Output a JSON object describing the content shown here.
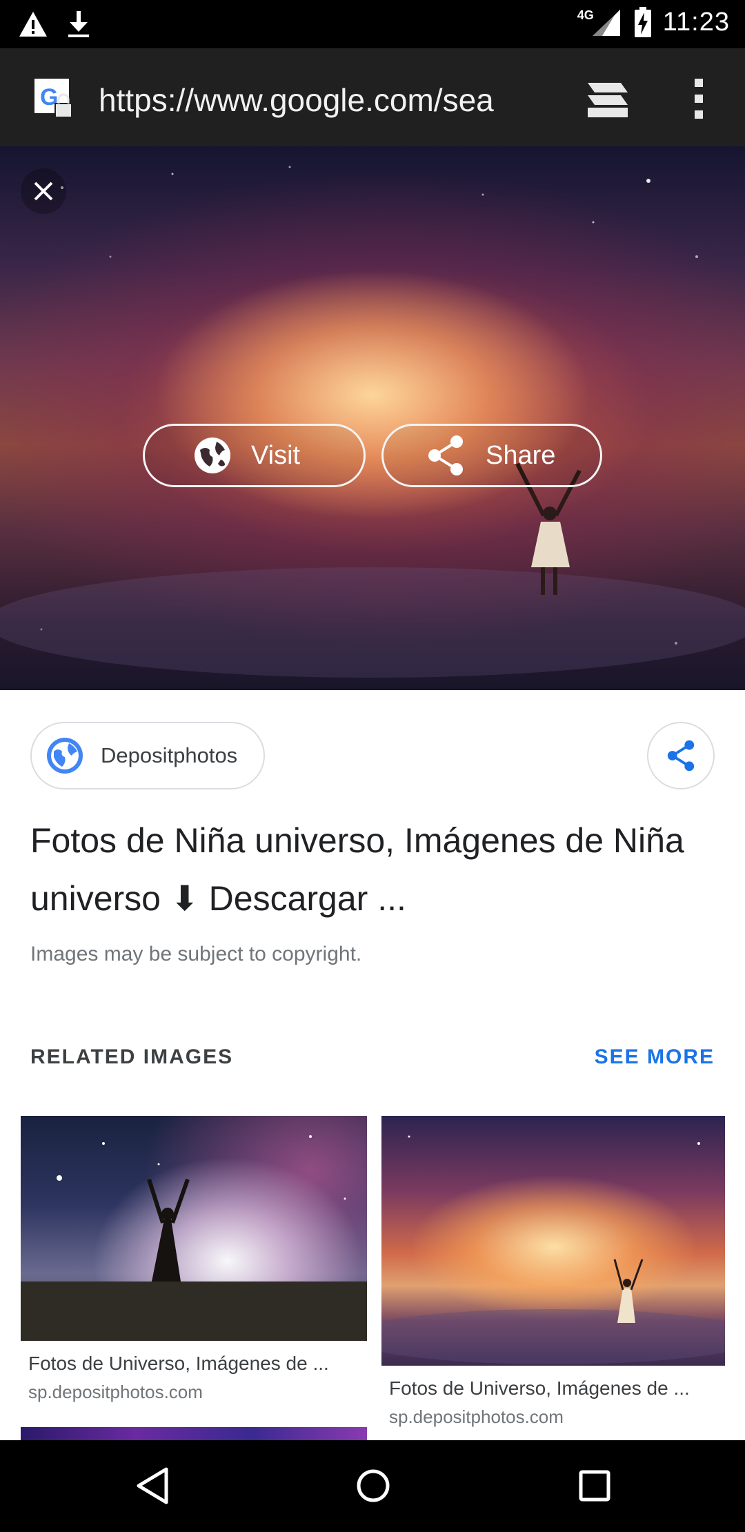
{
  "status_bar": {
    "time": "11:23",
    "network": "4G",
    "icons": [
      "warning-icon",
      "download-icon",
      "signal-icon",
      "battery-charging-icon"
    ]
  },
  "browser": {
    "url": "https://www.google.com/sea",
    "icons": [
      "google-favicon",
      "lock-icon",
      "tab-switcher-icon",
      "overflow-menu-icon"
    ]
  },
  "hero": {
    "visit_label": "Visit",
    "share_label": "Share"
  },
  "result": {
    "source_name": "Depositphotos",
    "title": "Fotos de Niña universo, Imágenes de Niña universo ⬇ Descargar ...",
    "copyright": "Images may be subject to copyright."
  },
  "related": {
    "heading": "RELATED IMAGES",
    "see_more": "SEE MORE",
    "items": [
      {
        "caption": "Fotos de Universo, Imágenes de ...",
        "source": "sp.depositphotos.com"
      },
      {
        "caption": "Fotos de Universo, Imágenes de ...",
        "source": "sp.depositphotos.com"
      }
    ]
  },
  "colors": {
    "accent": "#1a73e8",
    "toolbar": "#202020",
    "text_primary": "#202124",
    "text_secondary": "#70757a"
  }
}
